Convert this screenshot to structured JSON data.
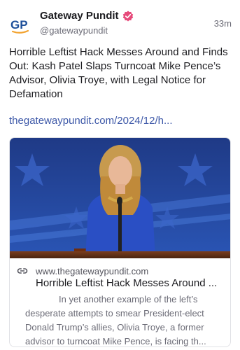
{
  "post": {
    "author": {
      "display_name": "Gateway Pundit",
      "handle": "@gatewaypundit",
      "avatar_text": "GP",
      "verified_icon": "verified-badge-icon"
    },
    "time_ago": "33m",
    "text": "Horrible Leftist Hack Messes Around and Finds Out: Kash Patel Slaps Turncoat Mike Pence’s Advisor, Olivia Troye, with Legal Notice for Defamation",
    "link_text": "thegatewaypundit.com/2024/12/h..."
  },
  "card": {
    "domain": "www.thegatewaypundit.com",
    "title": "Horrible Leftist Hack Messes Around ...",
    "description": "In yet another example of the left’s desperate attempts to smear President-elect Donald Trump’s allies, Olivia Troye, a former advisor to turncoat Mike Pence, is facing th...",
    "link_icon": "link-icon"
  },
  "colors": {
    "accent": "#3d58a8",
    "verified": "#e64a7a",
    "logo_blue": "#1d4f9a",
    "logo_orange": "#f2a330"
  }
}
